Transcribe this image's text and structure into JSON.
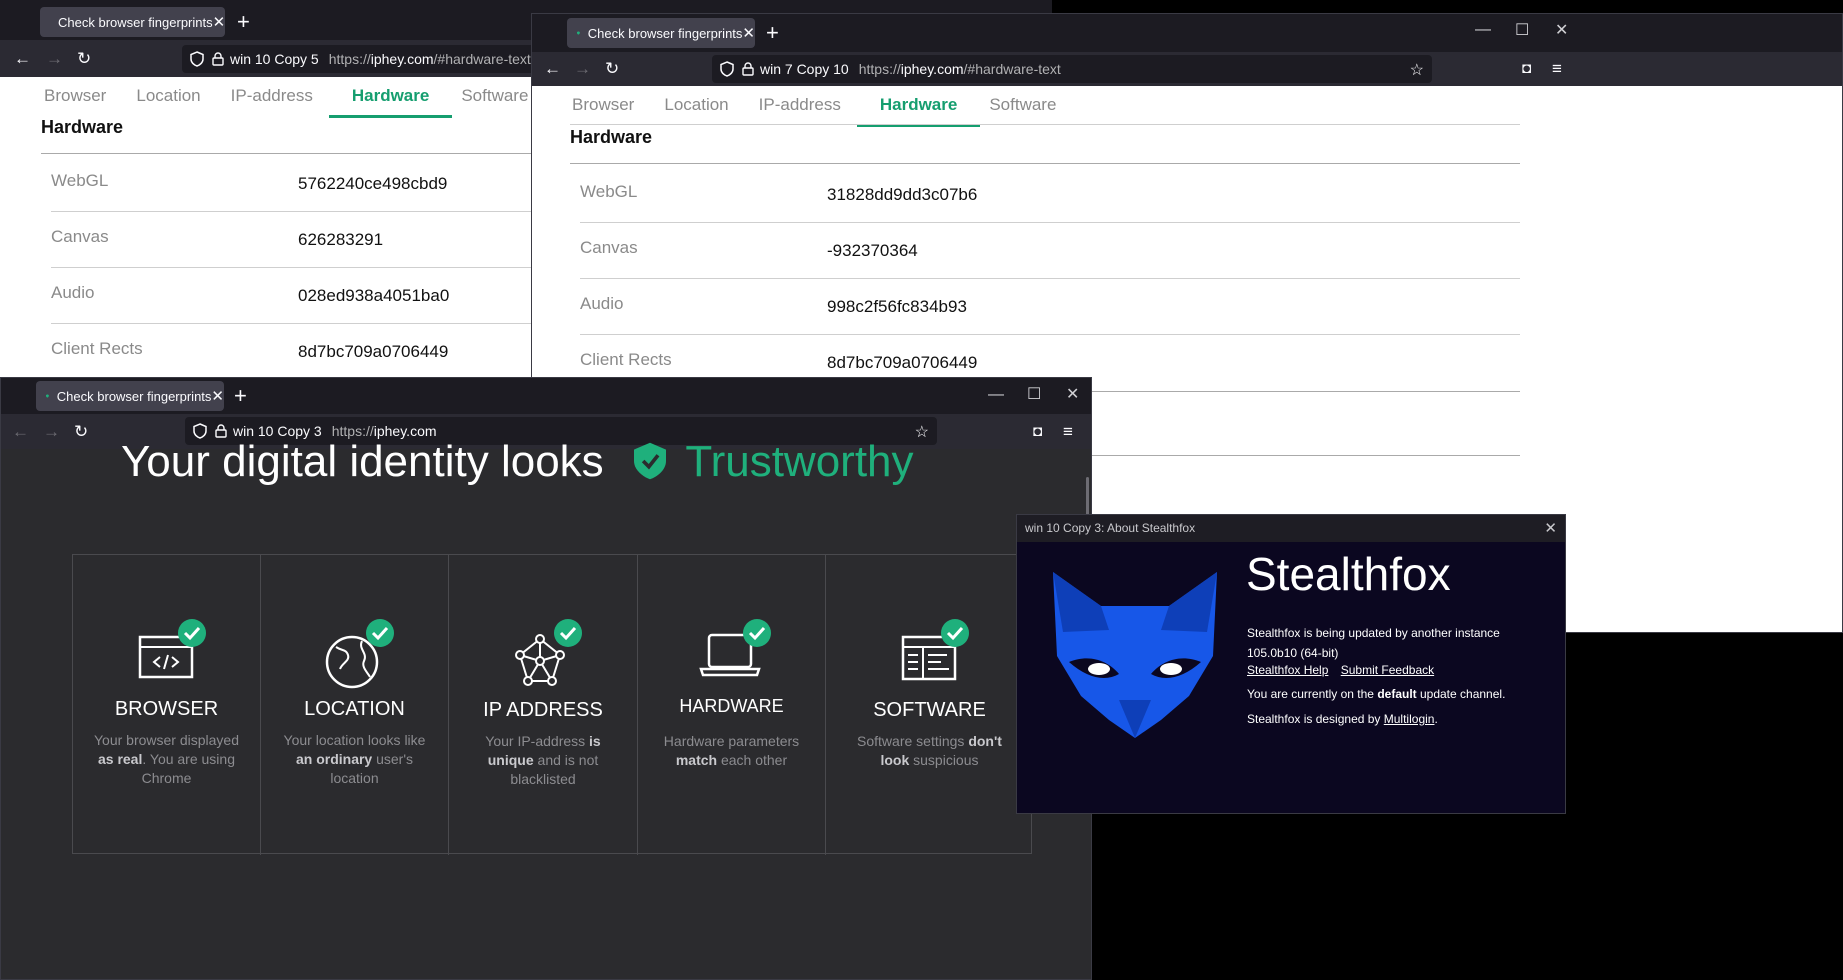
{
  "window1": {
    "tab_title": "Check browser fingerprints",
    "container": "win 10 Copy 5",
    "url_proto": "https://",
    "url_host": "iphey.com",
    "url_path": "/#hardware-text",
    "page_tabs": [
      "Browser",
      "Location",
      "IP-address",
      "Hardware",
      "Software"
    ],
    "active_tab": "Hardware",
    "section_title": "Hardware",
    "rows": [
      {
        "label": "WebGL",
        "value": "5762240ce498cbd9"
      },
      {
        "label": "Canvas",
        "value": "626283291"
      },
      {
        "label": "Audio",
        "value": "028ed938a4051ba0"
      },
      {
        "label": "Client Rects",
        "value": "8d7bc709a0706449"
      }
    ]
  },
  "window2": {
    "tab_title": "Check browser fingerprints",
    "container": "win 7 Copy 10",
    "url_proto": "https://",
    "url_host": "iphey.com",
    "url_path": "/#hardware-text",
    "page_tabs": [
      "Browser",
      "Location",
      "IP-address",
      "Hardware",
      "Software"
    ],
    "active_tab": "Hardware",
    "section_title": "Hardware",
    "rows": [
      {
        "label": "WebGL",
        "value": "31828dd9dd3c07b6"
      },
      {
        "label": "Canvas",
        "value": "-932370364"
      },
      {
        "label": "Audio",
        "value": "998c2f56fc834b93"
      },
      {
        "label": "Client Rects",
        "value": "8d7bc709a0706449"
      }
    ]
  },
  "window3": {
    "tab_title": "Check browser fingerprints",
    "container": "win 10 Copy 3",
    "url_proto": "https://",
    "url_host": "iphey.com",
    "url_path": "",
    "headline_main": "Your digital identity looks",
    "headline_accent": "Trustworthy",
    "cards": [
      {
        "name": "BROWSER",
        "icon": "browser-code-icon",
        "desc_html": "Your browser displayed <b>as real</b>. You are using Chrome"
      },
      {
        "name": "LOCATION",
        "icon": "globe-icon",
        "desc_html": "Your location looks like <b>an ordinary</b> user's location"
      },
      {
        "name": "IP ADDRESS",
        "icon": "network-icon",
        "desc_html": "Your IP-address <b>is unique</b> and is not blacklisted"
      },
      {
        "name": "HARDWARE",
        "icon": "laptop-icon",
        "desc_html": "Hardware parameters <b>match</b> each other"
      },
      {
        "name": "SOFTWARE",
        "icon": "software-window-icon",
        "desc_html": "Software settings <b>don't look</b> suspicious"
      }
    ]
  },
  "about": {
    "title": "win 10 Copy 3: About Stealthfox",
    "app_name": "Stealthfox",
    "update_status": "Stealthfox is being updated by another instance",
    "version": "105.0b10 (64-bit)",
    "help_link": "Stealthfox Help",
    "feedback_link": "Submit Feedback",
    "channel_pre": "You are currently on the ",
    "channel_name": "default",
    "channel_post": " update channel.",
    "designed_pre": "Stealthfox is designed by ",
    "designed_link": "Multilogin",
    "designed_post": "."
  },
  "colors": {
    "accent_green": "#159e6f",
    "check_green": "#1fb07c",
    "fox_blue": "#1757e8",
    "firefox_dark": "#1c1b22"
  }
}
